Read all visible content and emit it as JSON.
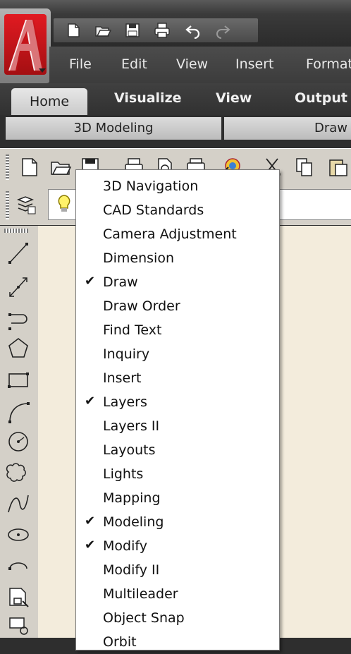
{
  "menubar": {
    "items": [
      "File",
      "Edit",
      "View",
      "Insert",
      "Format"
    ]
  },
  "ribbon": {
    "tabs": [
      "Home",
      "Visualize",
      "View",
      "Output"
    ],
    "panels": [
      "3D Modeling",
      "Draw"
    ]
  },
  "context_menu": {
    "items": [
      {
        "label": "3D Navigation",
        "checked": false
      },
      {
        "label": "CAD Standards",
        "checked": false
      },
      {
        "label": "Camera Adjustment",
        "checked": false
      },
      {
        "label": "Dimension",
        "checked": false
      },
      {
        "label": "Draw",
        "checked": true
      },
      {
        "label": "Draw Order",
        "checked": false
      },
      {
        "label": "Find Text",
        "checked": false
      },
      {
        "label": "Inquiry",
        "checked": false
      },
      {
        "label": "Insert",
        "checked": false
      },
      {
        "label": "Layers",
        "checked": true
      },
      {
        "label": "Layers II",
        "checked": false
      },
      {
        "label": "Layouts",
        "checked": false
      },
      {
        "label": "Lights",
        "checked": false
      },
      {
        "label": "Mapping",
        "checked": false
      },
      {
        "label": "Modeling",
        "checked": true
      },
      {
        "label": "Modify",
        "checked": true
      },
      {
        "label": "Modify II",
        "checked": false
      },
      {
        "label": "Multileader",
        "checked": false
      },
      {
        "label": "Object Snap",
        "checked": false
      },
      {
        "label": "Orbit",
        "checked": false
      }
    ],
    "check_glyph": "✔"
  },
  "colors": {
    "logo_red": "#d01a20",
    "ribbon_dark": "#333333",
    "toolbar_gray": "#d4d0c8",
    "canvas": "#f3ecdc"
  },
  "icons": {
    "quick_access": [
      "new-file-icon",
      "open-folder-icon",
      "save-icon",
      "print-icon",
      "undo-icon",
      "redo-icon"
    ],
    "toolbar": [
      "new-file-icon",
      "open-folder-icon",
      "save-icon",
      "plot-icon",
      "plot-preview-icon",
      "publish-icon",
      "render-icon",
      "cut-icon",
      "copy-icon",
      "paste-icon"
    ],
    "draw_toolbar": [
      "line-icon",
      "construction-line-icon",
      "polyline-icon",
      "polygon-icon",
      "rectangle-icon",
      "arc-icon",
      "circle-icon",
      "revision-cloud-icon",
      "spline-icon",
      "ellipse-icon",
      "ellipse-arc-icon",
      "insert-block-icon",
      "make-block-icon"
    ]
  }
}
